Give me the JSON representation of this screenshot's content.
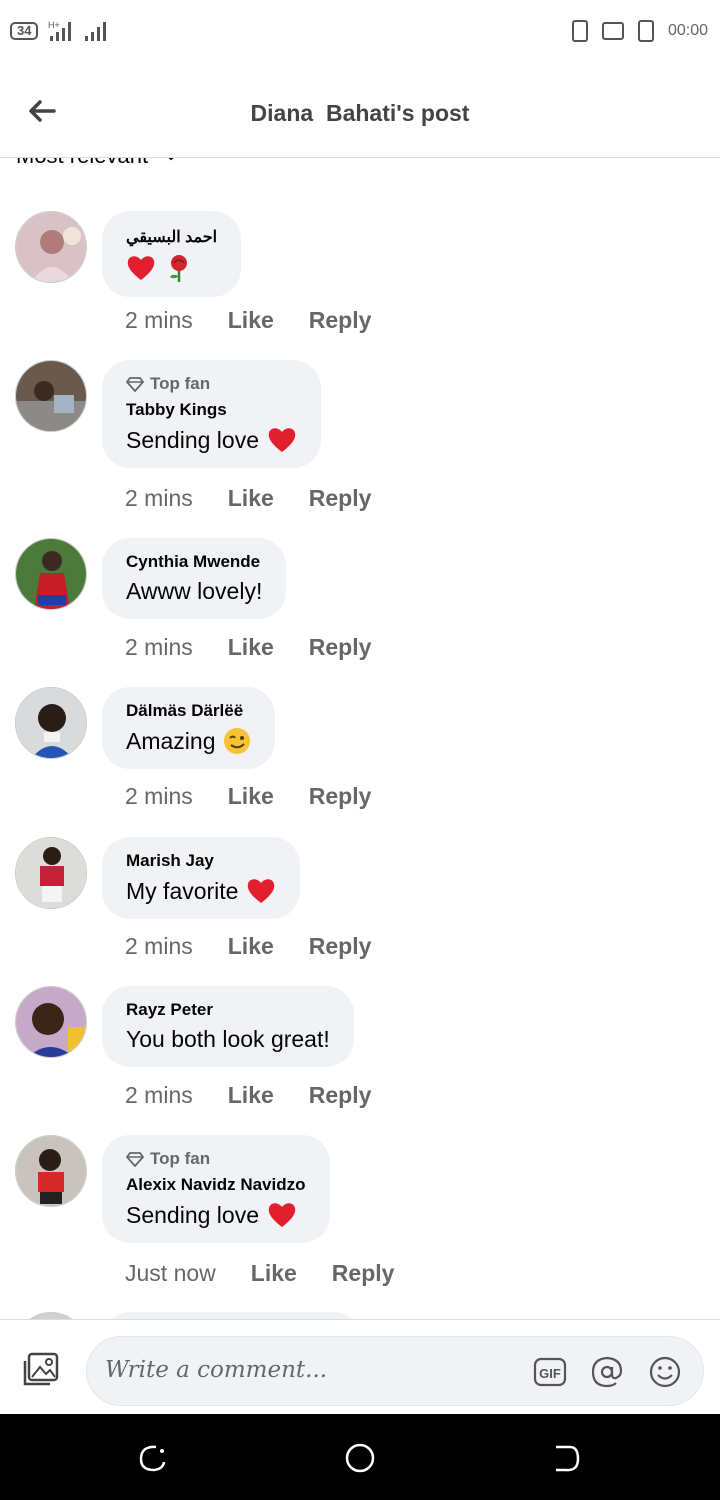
{
  "status_bar": {
    "network_badge": "34",
    "signal_text": "H+",
    "time": "00:00"
  },
  "header": {
    "title": "Diana  Bahati's post",
    "back_icon": "arrow-left-icon"
  },
  "sort": {
    "label": "Most relevant",
    "icon": "chevron-down-icon"
  },
  "comments": [
    {
      "top_fan": false,
      "name": "احمد البسيقي",
      "text": "",
      "emojis": [
        "heart",
        "rose"
      ],
      "time": "2 mins"
    },
    {
      "top_fan": true,
      "name": "Tabby Kings",
      "text": "Sending love",
      "emojis": [
        "heart"
      ],
      "time": "2 mins"
    },
    {
      "top_fan": false,
      "name": "Cynthia Mwende",
      "text": "Awww lovely!",
      "emojis": [],
      "time": "2 mins"
    },
    {
      "top_fan": false,
      "name": "Dälmäs Därlëë",
      "text": "Amazing",
      "emojis": [
        "wink"
      ],
      "time": "2 mins"
    },
    {
      "top_fan": false,
      "name": "Marish Jay",
      "text": "My favorite",
      "emojis": [
        "heart"
      ],
      "time": "2 mins"
    },
    {
      "top_fan": false,
      "name": "Rayz Peter",
      "text": "You both look great!",
      "emojis": [],
      "time": "2 mins"
    },
    {
      "top_fan": true,
      "name": "Alexix Navidz Navidzo",
      "text": "Sending love",
      "emojis": [
        "heart"
      ],
      "time": "Just now"
    }
  ],
  "labels": {
    "top_fan": "Top fan",
    "like": "Like",
    "reply": "Reply"
  },
  "composer": {
    "placeholder": "Write a comment...",
    "gif_label": "GIF"
  },
  "colors": {
    "bubble_bg": "#f0f2f5",
    "meta_text": "#65676b",
    "heart": "#e0202e"
  }
}
